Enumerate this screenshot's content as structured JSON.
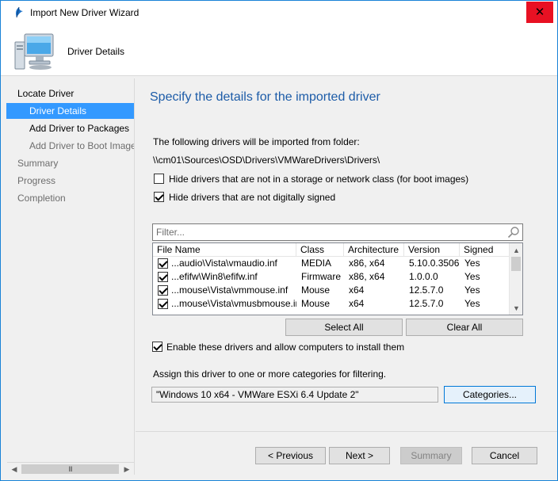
{
  "window": {
    "title": "Import New Driver Wizard"
  },
  "header": {
    "title": "Driver Details"
  },
  "nav": {
    "items": [
      {
        "label": "Locate Driver"
      },
      {
        "label": "Driver Details"
      },
      {
        "label": "Add Driver to Packages"
      },
      {
        "label": "Add Driver to Boot Images"
      },
      {
        "label": "Summary"
      },
      {
        "label": "Progress"
      },
      {
        "label": "Completion"
      }
    ],
    "scroll_grip": "III"
  },
  "content": {
    "title": "Specify the details for the imported driver",
    "folder_intro": "The following drivers will be imported from folder:",
    "folder_path": "\\\\cm01\\Sources\\OSD\\Drivers\\VMWareDrivers\\Drivers\\",
    "hide_storage_label": "Hide drivers that are not in a storage or network class (for boot images)",
    "hide_unsigned_label": "Hide drivers that are not digitally signed",
    "hide_storage_checked": false,
    "hide_unsigned_checked": true
  },
  "filter": {
    "placeholder": "Filter..."
  },
  "table": {
    "columns": [
      "File Name",
      "Class",
      "Architecture",
      "Version",
      "Signed"
    ],
    "rows": [
      {
        "checked": true,
        "file": "...audio\\Vista\\vmaudio.inf",
        "class": "MEDIA",
        "arch": "x86, x64",
        "version": "5.10.0.3506",
        "signed": "Yes"
      },
      {
        "checked": true,
        "file": "...efifw\\Win8\\efifw.inf",
        "class": "Firmware",
        "arch": "x86, x64",
        "version": "1.0.0.0",
        "signed": "Yes"
      },
      {
        "checked": true,
        "file": "...mouse\\Vista\\vmmouse.inf",
        "class": "Mouse",
        "arch": "x64",
        "version": "12.5.7.0",
        "signed": "Yes"
      },
      {
        "checked": true,
        "file": "...mouse\\Vista\\vmusbmouse.inf",
        "class": "Mouse",
        "arch": "x64",
        "version": "12.5.7.0",
        "signed": "Yes"
      }
    ]
  },
  "buttons": {
    "select_all": "Select All",
    "clear_all": "Clear All",
    "categories": "Categories...",
    "previous": "< Previous",
    "next": "Next >",
    "summary": "Summary",
    "cancel": "Cancel"
  },
  "enable": {
    "label": "Enable these drivers and allow computers to install them",
    "checked": true
  },
  "categories": {
    "label": "Assign this driver to one or more categories for filtering.",
    "value": "\"Windows 10 x64 - VMWare ESXi 6.4 Update 2\""
  },
  "colors": {
    "accent": "#1d5ca8",
    "selection": "#3399ff",
    "close": "#e81123",
    "window_border": "#1883d7"
  }
}
